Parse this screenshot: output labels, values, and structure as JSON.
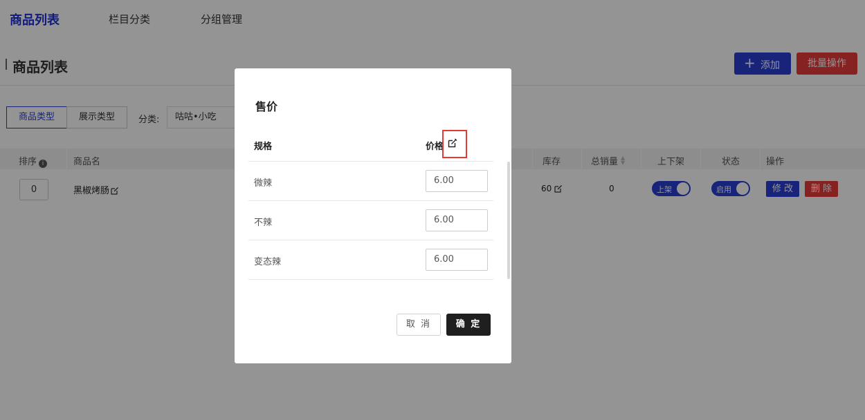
{
  "nav": {
    "items": [
      {
        "label": "商品列表",
        "active": true
      },
      {
        "label": "栏目分类",
        "active": false
      },
      {
        "label": "分组管理",
        "active": false
      }
    ]
  },
  "page": {
    "title": "商品列表",
    "add_label": "添加",
    "batch_label": "批量操作"
  },
  "filters": {
    "tabs": [
      {
        "label": "商品类型",
        "active": true
      },
      {
        "label": "展示类型",
        "active": false
      }
    ],
    "category_label": "分类:",
    "category_value": "咕咕•小吃"
  },
  "table": {
    "headers": {
      "sort": "排序",
      "name": "商品名",
      "stock": "库存",
      "sales": "总销量",
      "shelf": "上下架",
      "status": "状态",
      "ops": "操作"
    },
    "rows": [
      {
        "sort": "0",
        "name": "黑椒烤肠",
        "stock": "60",
        "sales": "0",
        "shelf": "上架",
        "status": "启用",
        "edit": "修 改",
        "delete": "删 除"
      }
    ]
  },
  "modal": {
    "title": "售价",
    "col_spec": "规格",
    "col_price": "价格",
    "rows": [
      {
        "spec": "微辣",
        "price": "6.00"
      },
      {
        "spec": "不辣",
        "price": "6.00"
      },
      {
        "spec": "变态辣",
        "price": "6.00"
      }
    ],
    "cancel": "取 消",
    "ok": "确 定"
  },
  "colors": {
    "primary": "#2a3ed3",
    "danger": "#e93b3b",
    "highlight": "#e53935",
    "dark_button": "#1f1f1f"
  }
}
